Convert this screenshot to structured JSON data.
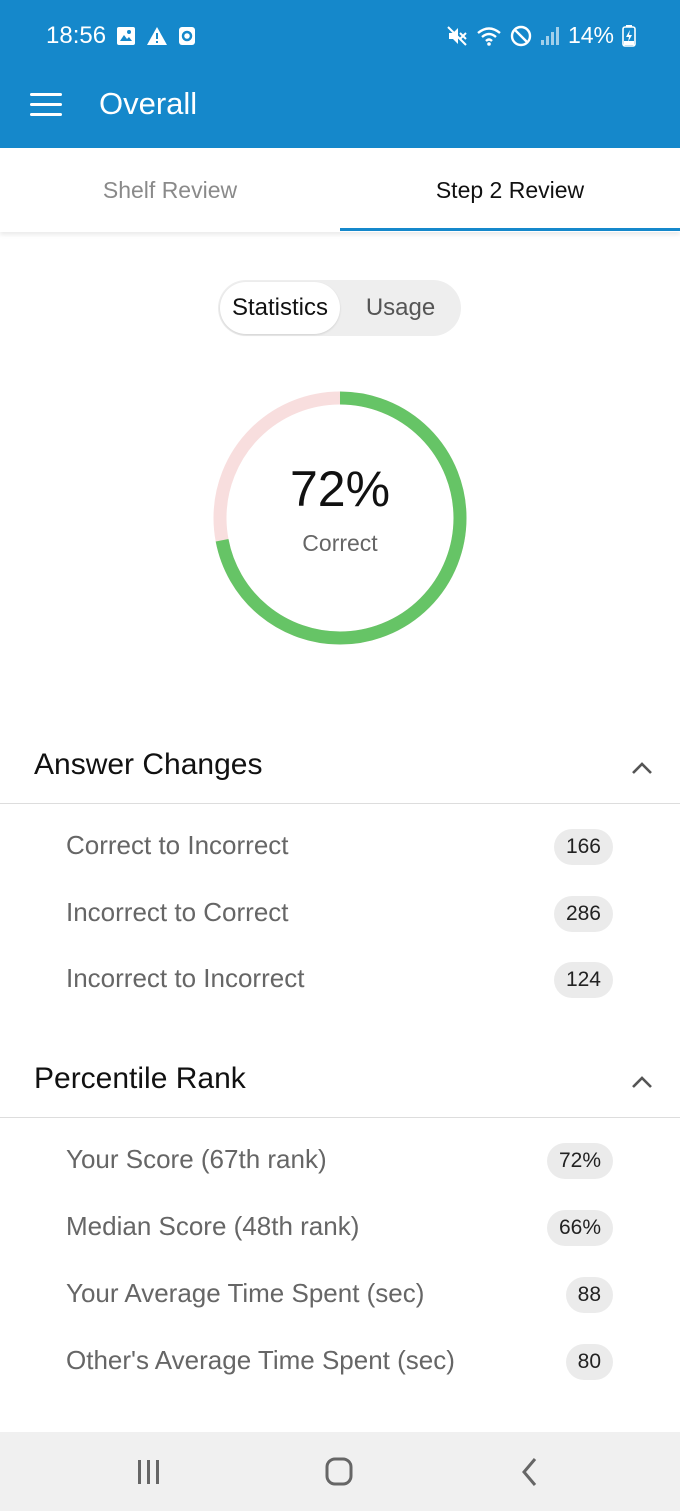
{
  "status_bar": {
    "time": "18:56",
    "battery": "14%",
    "left_icons": [
      "image-icon",
      "warning-icon",
      "app-notification-icon"
    ],
    "right_icons": [
      "mute-icon",
      "wifi-icon",
      "do-not-disturb-icon",
      "signal-icon",
      "battery-charging-icon"
    ]
  },
  "app_bar": {
    "title": "Overall",
    "menu_icon": "menu-icon",
    "color": "#1588cb"
  },
  "tabs": [
    {
      "label": "Shelf Review",
      "selected": false
    },
    {
      "label": "Step 2 Review",
      "selected": true
    }
  ],
  "segmented": {
    "options": [
      "Statistics",
      "Usage"
    ],
    "selected": "Statistics"
  },
  "score": {
    "percent_text": "72%",
    "label": "Correct",
    "value": 72,
    "correct_color": "#66c466",
    "incorrect_color": "#f8dede"
  },
  "answer_changes": {
    "title": "Answer Changes",
    "expanded": true,
    "rows": [
      {
        "label": "Correct to Incorrect",
        "value": "166"
      },
      {
        "label": "Incorrect to Correct",
        "value": "286"
      },
      {
        "label": "Incorrect to Incorrect",
        "value": "124"
      }
    ]
  },
  "percentile_rank": {
    "title": "Percentile Rank",
    "expanded": true,
    "rows": [
      {
        "label": "Your Score (67th rank)",
        "value": "72%"
      },
      {
        "label": "Median Score (48th rank)",
        "value": "66%"
      },
      {
        "label": "Your Average Time Spent (sec)",
        "value": "88"
      },
      {
        "label": "Other's Average Time Spent (sec)",
        "value": "80"
      }
    ]
  },
  "nav_bar": {
    "buttons": [
      "recent-apps-icon",
      "home-icon",
      "back-icon"
    ]
  }
}
